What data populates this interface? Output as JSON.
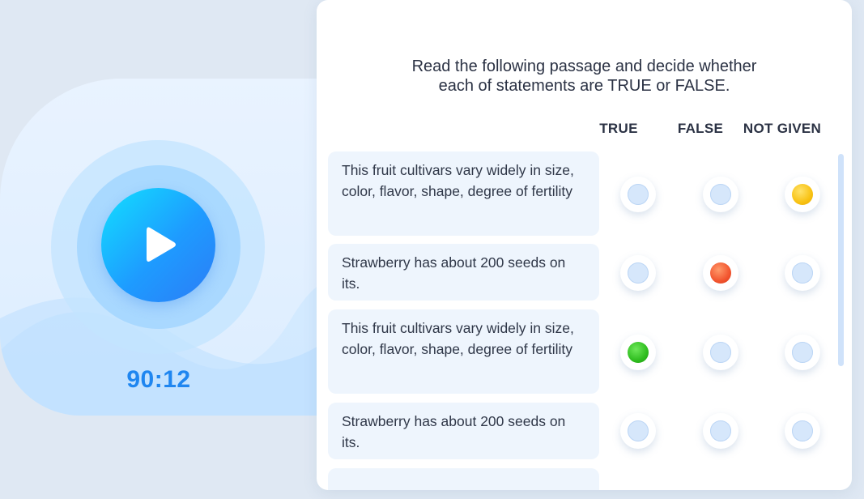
{
  "player": {
    "timer": "90:12",
    "play_icon": "play-icon"
  },
  "quiz": {
    "instructions_line1": "Read the following passage and decide whether",
    "instructions_line2": "each of statements are TRUE or FALSE.",
    "columns": [
      "TRUE",
      "FALSE",
      "NOT GIVEN"
    ],
    "statements": [
      {
        "text": "This fruit cultivars vary widely in size, color, flavor, shape, degree of fertility",
        "selected": "NOT GIVEN"
      },
      {
        "text": "Strawberry has about 200 seeds on its.",
        "selected": "FALSE"
      },
      {
        "text": "This fruit cultivars vary widely in size, color, flavor, shape, degree of fertility",
        "selected": "TRUE"
      },
      {
        "text": "Strawberry has about 200 seeds on its.",
        "selected": null
      },
      {
        "text": "",
        "selected": null
      }
    ]
  },
  "colors": {
    "accent_blue": "#1f86f0",
    "selected_true": "#2fbd1f",
    "selected_false": "#f2552f",
    "selected_not_given": "#f8c213",
    "unselected": "#d6e7fb"
  }
}
